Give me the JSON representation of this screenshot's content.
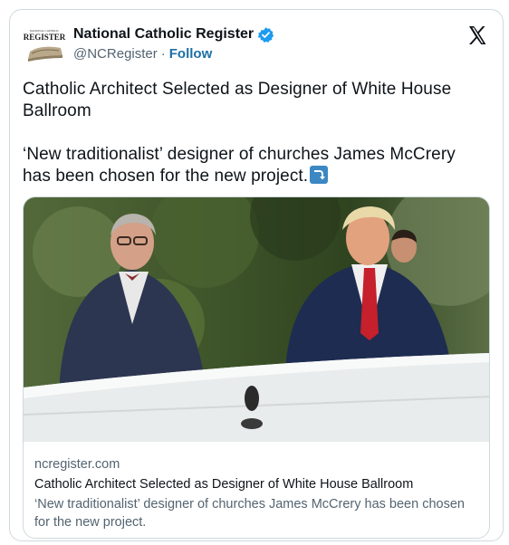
{
  "account": {
    "display_name": "National Catholic Register",
    "handle": "@NCRegister",
    "separator": "·",
    "follow_label": "Follow",
    "avatar_text": "REGISTER",
    "avatar_small_text": "NATIONAL CATHOLIC"
  },
  "tweet": {
    "line1": "Catholic Architect Selected as Designer of White House Ballroom",
    "line2": "‘New traditionalist’ designer of churches James McCrery has been chosen for the new project."
  },
  "link_card": {
    "domain": "ncregister.com",
    "title": "Catholic Architect Selected as Designer of White House Ballroom",
    "description": "‘New traditionalist’ designer of churches James McCrery has been chosen for the new project."
  },
  "icons": {
    "verified": "verified-badge-icon",
    "x_logo": "x-logo-icon",
    "emoji": "right-arrow-curving-down-emoji"
  },
  "colors": {
    "verified_blue": "#1d9bf0",
    "follow_blue": "#1d6fa5",
    "muted_text": "#536471",
    "border": "#cfd9de"
  }
}
